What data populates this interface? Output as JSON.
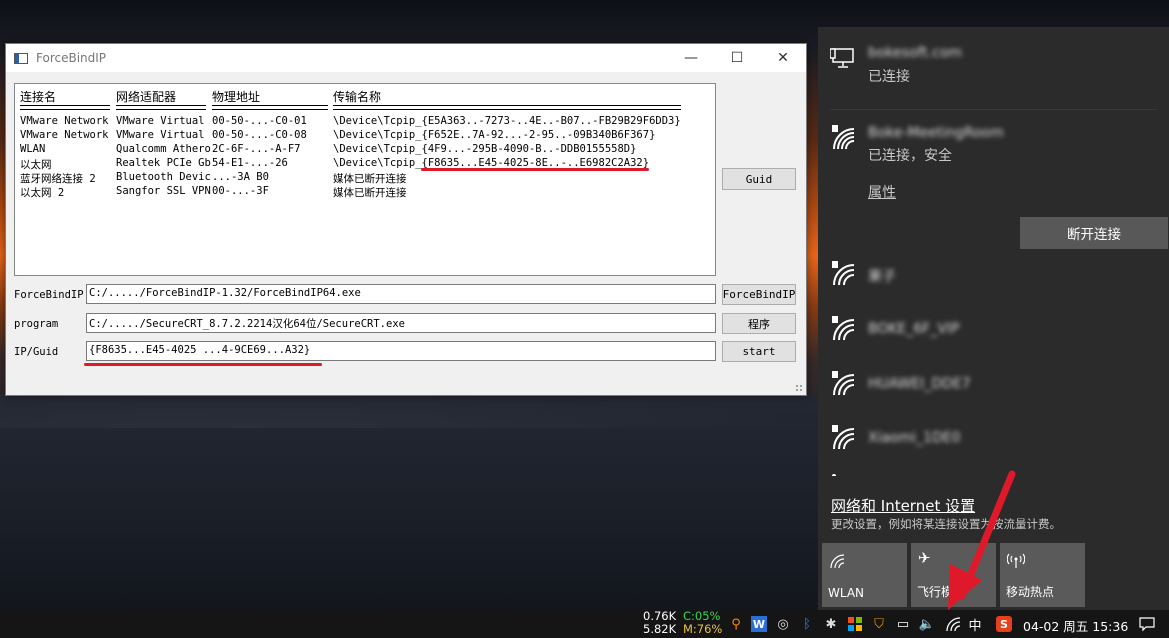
{
  "window": {
    "title": "ForceBindIP",
    "minimize_glyph": "—",
    "maximize_glyph": "☐",
    "close_glyph": "✕"
  },
  "list": {
    "headers": [
      "连接名",
      "网络适配器",
      "物理地址",
      "传输名称"
    ],
    "rows": [
      {
        "name": "VMware Network",
        "adapter": "VMware Virtual",
        "mac": "00-50-...-C0-01",
        "transport": "\\Device\\Tcpip_{E5A363..-7273-..4E..-B07..-FB29B29F6DD3}"
      },
      {
        "name": "VMware Network",
        "adapter": "VMware Virtual",
        "mac": "00-50-...-C0-08",
        "transport": "\\Device\\Tcpip_{F652E..7A-92...-2-95..-09B340B6F367}"
      },
      {
        "name": "WLAN",
        "adapter": "Qualcomm Athero",
        "mac": "2C-6F-...-A-F7",
        "transport": "\\Device\\Tcpip_{4F9...-295B-4090-B..-DDB0155558D}"
      },
      {
        "name": "以太网",
        "adapter": "Realtek PCIe Gb",
        "mac": "54-E1-...-26",
        "transport": "\\Device\\Tcpip_{F8635...E45-4025-8E..-..E6982C2A32}"
      },
      {
        "name": "蓝牙网络连接 2",
        "adapter": "Bluetooth Devic",
        "mac": "...-3A B0",
        "transport": "媒体已断开连接"
      },
      {
        "name": "以太网 2",
        "adapter": "Sangfor SSL VPN",
        "mac": "00-...-3F",
        "transport": "媒体已断开连接"
      }
    ]
  },
  "buttons": {
    "guid": "Guid",
    "forcebindip": "ForceBindIP",
    "program": "程序",
    "start": "start"
  },
  "fields": {
    "forcebindip_label": "ForceBindIP",
    "forcebindip_value": "C:/...../ForceBindIP-1.32/ForceBindIP64.exe",
    "program_label": "program",
    "program_value": "C:/...../SecureCRT_8.7.2.2214汉化64位/SecureCRT.exe",
    "ipguid_label": "IP/Guid",
    "ipguid_value": "{F8635...E45-4025   ...4-9CE69...A32}"
  },
  "flyout": {
    "wired_name": "bokesoft.com",
    "wired_status": "已连接",
    "wifi_connected_name": "Boke-MeetingRoom",
    "wifi_connected_status": "已连接，安全",
    "properties": "属性",
    "disconnect": "断开连接",
    "other_networks": [
      "果子",
      "BOKE_6F_VIP",
      "HUAWEI_DDE7",
      "Xiaomi_1DE0"
    ],
    "settings_link": "网络和 Internet 设置",
    "settings_desc": "更改设置，例如将某连接设置为按流量计费。",
    "tiles": [
      {
        "label": "WLAN",
        "icon": "wifi-icon"
      },
      {
        "label": "飞行模式",
        "icon": "airplane-icon"
      },
      {
        "label": "移动热点",
        "icon": "hotspot-icon"
      }
    ]
  },
  "taskbar": {
    "net_up": "0.76K",
    "net_down": "5.82K",
    "cpu": "C:05%",
    "mem": "M:76%",
    "ime": "中",
    "clock": "04-02 周五 15:36",
    "colors": {
      "cpu": "#39d353",
      "mem": "#e6c34a"
    }
  }
}
